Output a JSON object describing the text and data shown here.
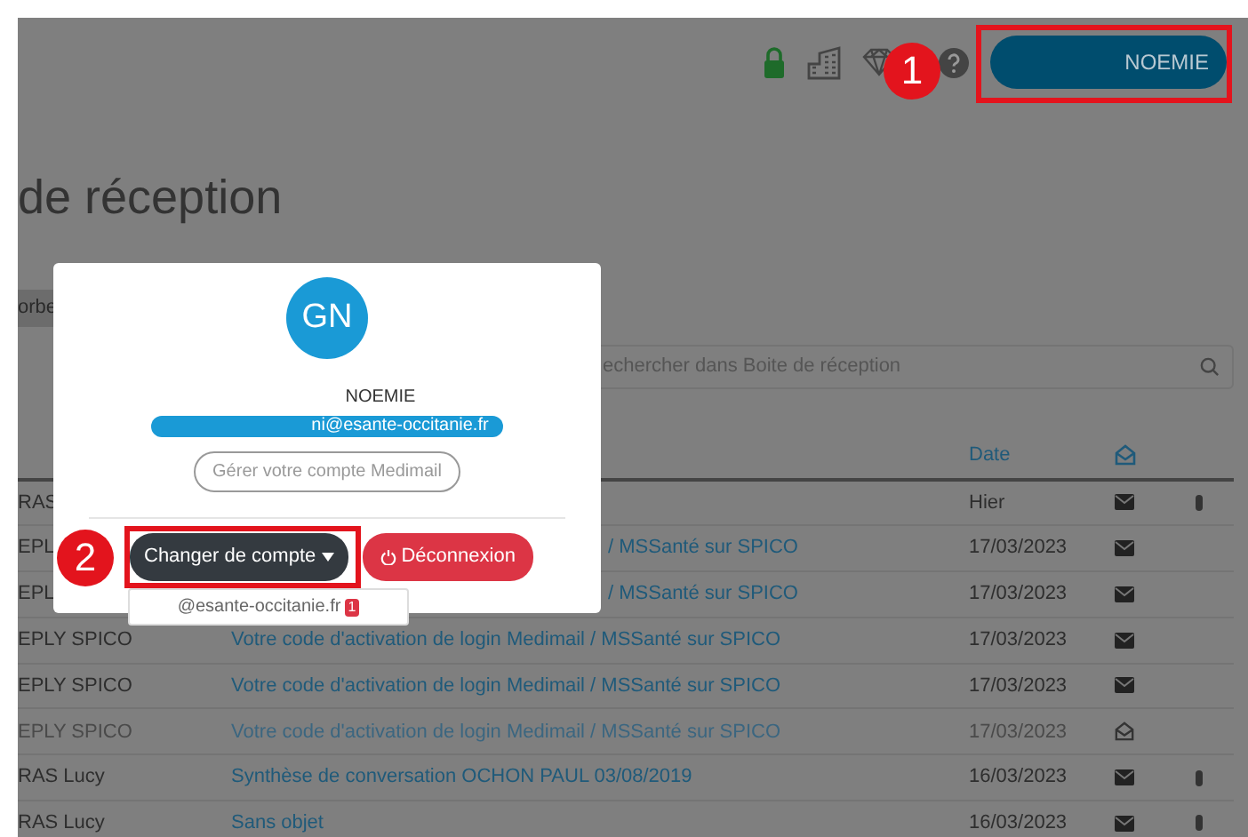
{
  "account_button": {
    "label": "NOEMIE"
  },
  "page_title": "de réception",
  "folder_tab": {
    "label": "orbe"
  },
  "search": {
    "placeholder": "echercher dans Boite de réception"
  },
  "table": {
    "columns": [
      "Date"
    ],
    "rows": [
      {
        "sender": "RAS",
        "date": "Hier",
        "unread": true,
        "attachment": true
      },
      {
        "sender": "EPL",
        "subject": "/ MSSanté sur SPICO",
        "date": "17/03/2023",
        "unread": true,
        "attachment": false
      },
      {
        "sender": "EPL",
        "subject": "/ MSSanté sur SPICO",
        "date": "17/03/2023",
        "unread": true,
        "attachment": false
      },
      {
        "sender": "EPLY SPICO",
        "subject": "Votre code d'activation de login Medimail / MSSanté sur SPICO",
        "date": "17/03/2023",
        "unread": true,
        "attachment": false
      },
      {
        "sender": "EPLY SPICO",
        "subject": "Votre code d'activation de login Medimail / MSSanté sur SPICO",
        "date": "17/03/2023",
        "unread": true,
        "attachment": false
      },
      {
        "sender": "EPLY SPICO",
        "subject": "Votre code d'activation de login Medimail / MSSanté sur SPICO",
        "date": "17/03/2023",
        "unread": false,
        "attachment": false
      },
      {
        "sender": "RAS Lucy",
        "subject": "Synthèse de conversation OCHON PAUL 03/08/2019",
        "date": "16/03/2023",
        "unread": true,
        "attachment": true
      },
      {
        "sender": "RAS Lucy",
        "subject": "Sans objet",
        "date": "16/03/2023",
        "unread": true,
        "attachment": true
      }
    ]
  },
  "account_popup": {
    "initials": "GN",
    "name": "NOEMIE",
    "email": "ni@esante-occitanie.fr",
    "manage_button": "Gérer votre compte Medimail",
    "switch_button": "Changer de compte",
    "logout_button": "Déconnexion",
    "accounts": [
      {
        "address": "@esante-occitanie.fr",
        "badge": "1"
      }
    ]
  },
  "callouts": [
    {
      "number": "1"
    },
    {
      "number": "2"
    }
  ]
}
